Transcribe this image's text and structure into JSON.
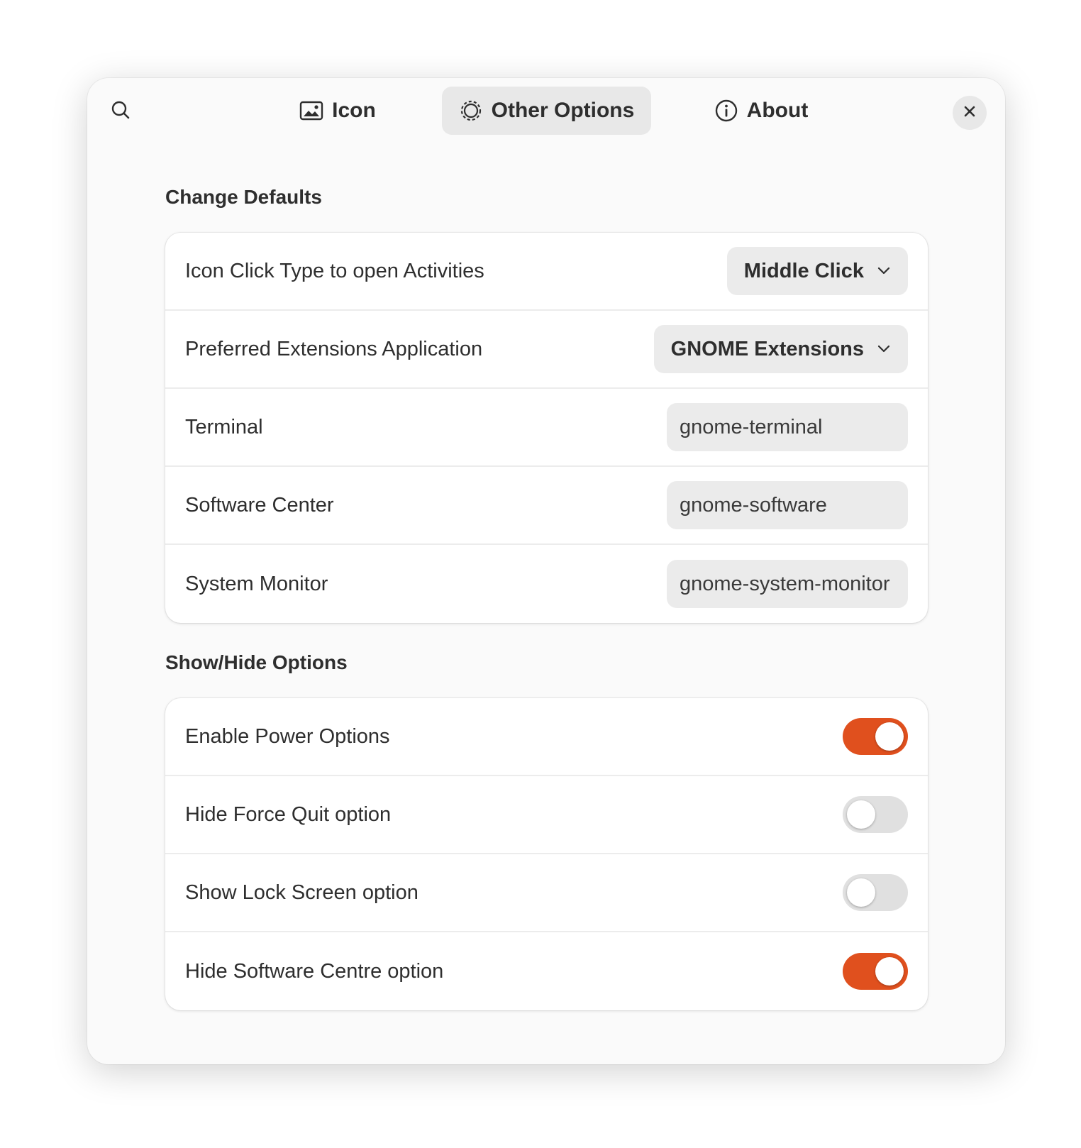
{
  "header": {
    "tabs": [
      {
        "label": "Icon",
        "icon": "image-icon",
        "active": false
      },
      {
        "label": "Other Options",
        "icon": "gear-icon",
        "active": true
      },
      {
        "label": "About",
        "icon": "info-icon",
        "active": false
      }
    ]
  },
  "change_defaults": {
    "title": "Change Defaults",
    "rows": [
      {
        "label": "Icon Click Type to open Activities",
        "control": "dropdown",
        "value": "Middle Click"
      },
      {
        "label": "Preferred Extensions Application",
        "control": "dropdown",
        "value": "GNOME Extensions"
      },
      {
        "label": "Terminal",
        "control": "entry",
        "value": "gnome-terminal"
      },
      {
        "label": "Software Center",
        "control": "entry",
        "value": "gnome-software"
      },
      {
        "label": "System Monitor",
        "control": "entry",
        "value": "gnome-system-monitor"
      }
    ]
  },
  "show_hide": {
    "title": "Show/Hide Options",
    "rows": [
      {
        "label": "Enable Power Options",
        "enabled": true
      },
      {
        "label": "Hide Force Quit option",
        "enabled": false
      },
      {
        "label": "Show Lock Screen option",
        "enabled": false
      },
      {
        "label": "Hide Software Centre option",
        "enabled": true
      }
    ]
  },
  "colors": {
    "accent": "#e0501e",
    "window_bg": "#fafafa",
    "card_bg": "#ffffff",
    "control_bg": "#ebebeb"
  }
}
